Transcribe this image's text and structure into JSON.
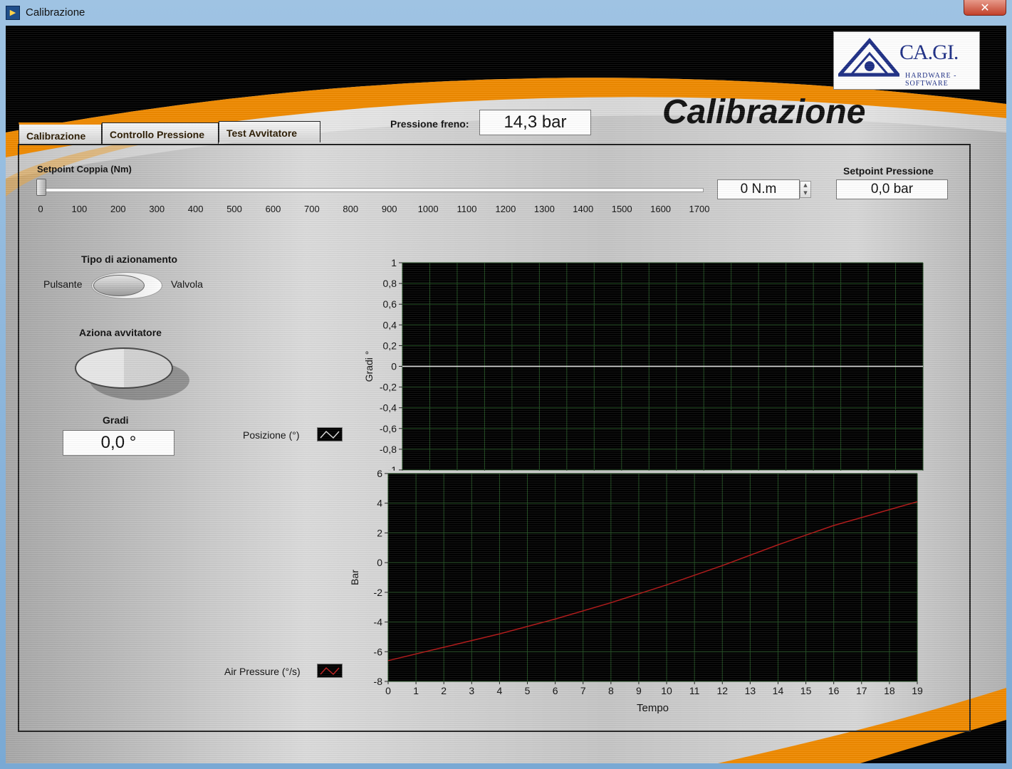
{
  "window": {
    "title": "Calibrazione",
    "close_glyph": "✕"
  },
  "logo": {
    "name": "CA.GI.",
    "tagline": "HARDWARE - SOFTWARE"
  },
  "header": {
    "title": "Calibrazione"
  },
  "tabs": [
    {
      "label": "Calibrazione",
      "active": true
    },
    {
      "label": "Controllo Pressione",
      "active": false
    },
    {
      "label": "Test Avvitatore",
      "active": false
    }
  ],
  "brake_pressure": {
    "label": "Pressione freno:",
    "value": "14,3 bar"
  },
  "torque": {
    "label": "Setpoint Coppia (Nm)",
    "value": "0 N.m",
    "slider_value": 0,
    "scale": [
      "0",
      "100",
      "200",
      "300",
      "400",
      "500",
      "600",
      "700",
      "800",
      "900",
      "1000",
      "1100",
      "1200",
      "1300",
      "1400",
      "1500",
      "1600",
      "1700"
    ]
  },
  "pressure_setpoint": {
    "label": "Setpoint Pressione",
    "value": "0,0 bar"
  },
  "actuation": {
    "label": "Tipo di azionamento",
    "left": "Pulsante",
    "right": "Valvola",
    "state": "Pulsante"
  },
  "screwdriver": {
    "label": "Aziona avvitatore"
  },
  "degrees": {
    "label": "Gradi",
    "value": "0,0 °"
  },
  "colors": {
    "orange": "#f08a00",
    "plot_bg": "#000000",
    "grid": "#1f4a1f",
    "trace_gradi": "#e8e8e8",
    "trace_bar": "#b01616"
  },
  "chart_data": [
    {
      "type": "line",
      "ylabel": "Gradi °",
      "xlabel": "",
      "legend": "Posizione (°)",
      "xlim": [
        0,
        19
      ],
      "ylim": [
        -1,
        1
      ],
      "x_ticks": [
        "0",
        "1",
        "2",
        "3",
        "4",
        "5",
        "6",
        "7",
        "8",
        "9",
        "10",
        "11",
        "12",
        "13",
        "14",
        "15",
        "16",
        "17",
        "18",
        "19"
      ],
      "y_ticks": [
        "1",
        "0,8",
        "0,6",
        "0,4",
        "0,2",
        "0",
        "-0,2",
        "-0,4",
        "-0,6",
        "-0,8",
        "-1"
      ],
      "series": [
        {
          "name": "Posizione (°)",
          "x": [
            0,
            19
          ],
          "y": [
            0,
            0
          ]
        }
      ],
      "grid": true
    },
    {
      "type": "line",
      "ylabel": "Bar",
      "xlabel": "Tempo",
      "legend": "Air Pressure (°/s)",
      "xlim": [
        0,
        19
      ],
      "ylim": [
        -8,
        6
      ],
      "x_ticks": [
        "0",
        "1",
        "2",
        "3",
        "4",
        "5",
        "6",
        "7",
        "8",
        "9",
        "10",
        "11",
        "12",
        "13",
        "14",
        "15",
        "16",
        "17",
        "18",
        "19"
      ],
      "y_ticks": [
        "6",
        "4",
        "2",
        "0",
        "-2",
        "-4",
        "-6",
        "-8"
      ],
      "series": [
        {
          "name": "Air Pressure (°/s)",
          "x": [
            0,
            2,
            4,
            6,
            8,
            10,
            12,
            14,
            16,
            19
          ],
          "y": [
            -6.6,
            -5.7,
            -4.8,
            -3.8,
            -2.7,
            -1.5,
            -0.2,
            1.2,
            2.5,
            4.1
          ]
        }
      ],
      "grid": true
    }
  ]
}
